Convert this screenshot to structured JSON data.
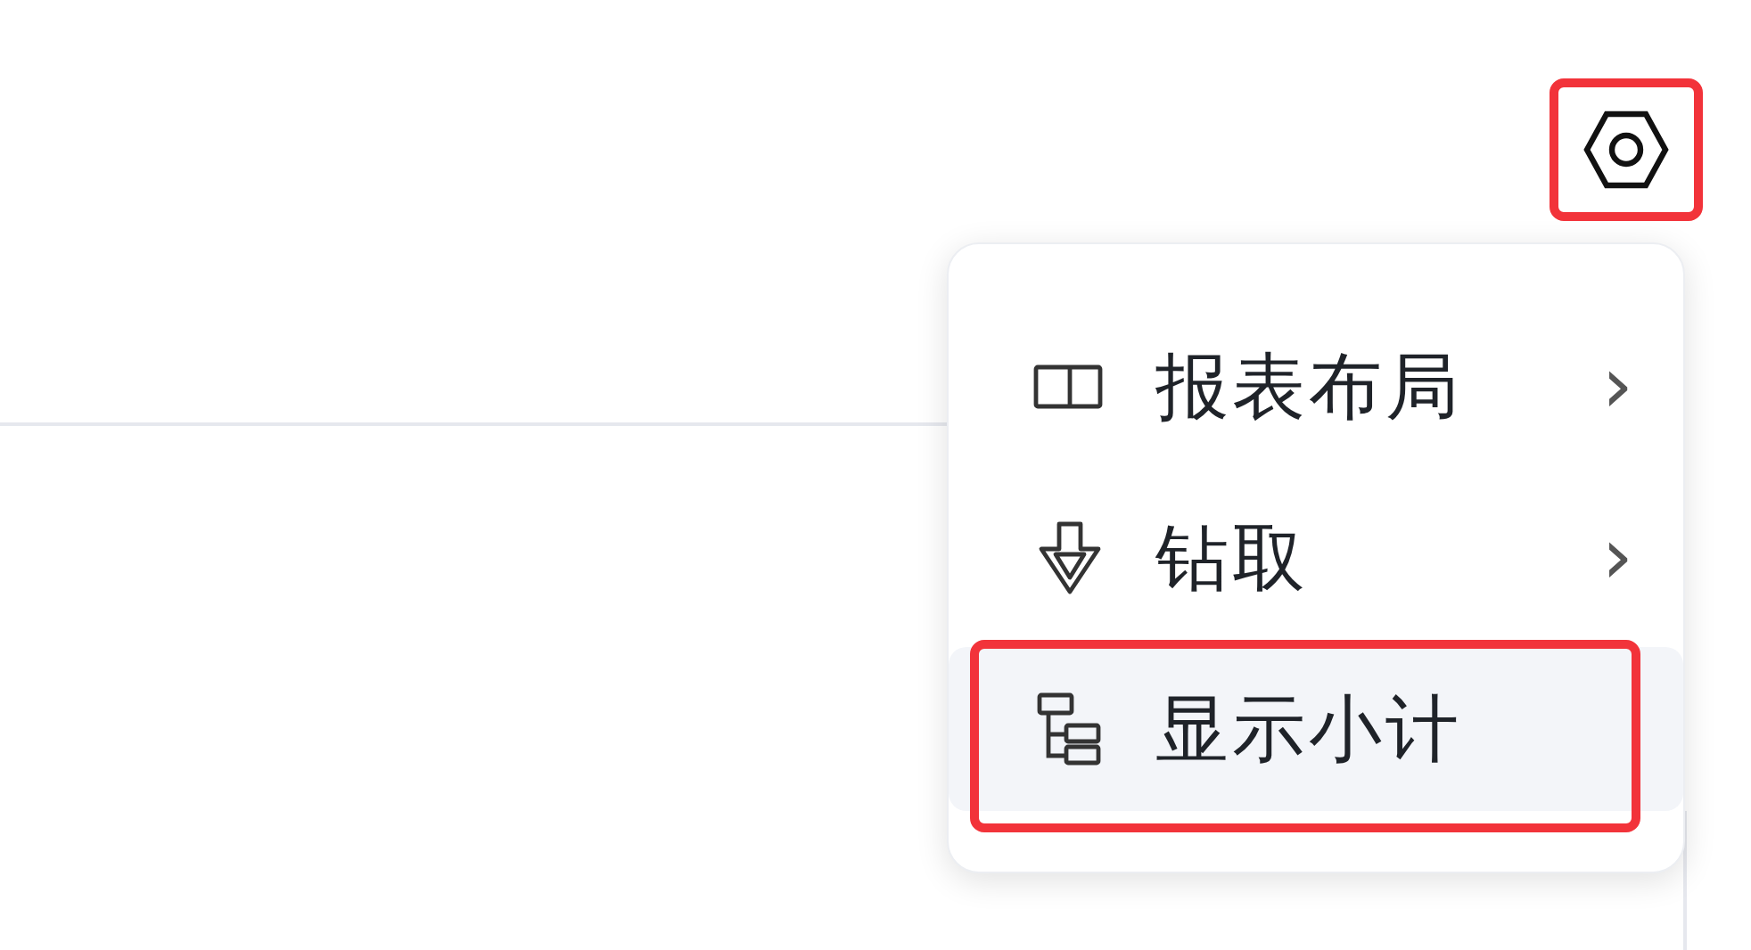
{
  "toolbar": {
    "settings_button": {
      "highlighted": true
    }
  },
  "menu": {
    "items": [
      {
        "kind": "layout",
        "label": "报表布局",
        "chevron": "›",
        "hovered": false,
        "highlighted": false
      },
      {
        "kind": "drill",
        "label": "钻取",
        "chevron": "›",
        "hovered": false,
        "highlighted": false
      },
      {
        "kind": "tree",
        "label": "显示小计",
        "hovered": true,
        "highlighted": true
      }
    ]
  }
}
